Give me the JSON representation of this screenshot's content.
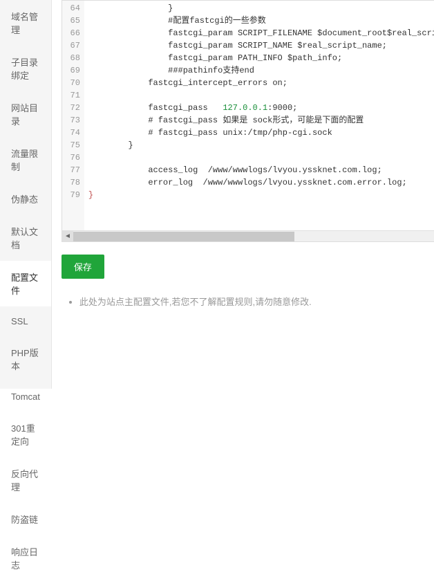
{
  "sidebar": {
    "items": [
      {
        "label": "域名管理"
      },
      {
        "label": "子目录绑定"
      },
      {
        "label": "网站目录"
      },
      {
        "label": "流量限制"
      },
      {
        "label": "伪静态"
      },
      {
        "label": "默认文档"
      },
      {
        "label": "配置文件"
      },
      {
        "label": "SSL"
      },
      {
        "label": "PHP版本"
      },
      {
        "label": "Tomcat"
      },
      {
        "label": "301重定向"
      },
      {
        "label": "反向代理"
      },
      {
        "label": "防盗链"
      },
      {
        "label": "响应日志"
      }
    ],
    "activeIndex": 6
  },
  "editor": {
    "startLine": 64,
    "lines": [
      {
        "indent": 16,
        "text": "}"
      },
      {
        "indent": 16,
        "text": "#配置fastcgi的一些参数"
      },
      {
        "indent": 16,
        "text": "fastcgi_param SCRIPT_FILENAME $document_root$real_script_name;"
      },
      {
        "indent": 16,
        "text": "fastcgi_param SCRIPT_NAME $real_script_name;"
      },
      {
        "indent": 16,
        "text": "fastcgi_param PATH_INFO $path_info;"
      },
      {
        "indent": 16,
        "text": "###pathinfo支持end"
      },
      {
        "indent": 12,
        "text": "fastcgi_intercept_errors on;"
      },
      {
        "indent": 0,
        "text": ""
      },
      {
        "indent": 12,
        "text": "fastcgi_pass   ",
        "num": "127.0.0.1",
        "after": ":9000;"
      },
      {
        "indent": 12,
        "text": "# fastcgi_pass 如果是 sock形式，可能是下面的配置"
      },
      {
        "indent": 12,
        "text": "# fastcgi_pass unix:/tmp/php-cgi.sock"
      },
      {
        "indent": 8,
        "text": "}"
      },
      {
        "indent": 0,
        "text": ""
      },
      {
        "indent": 12,
        "text": "access_log  /www/wwwlogs/lvyou.yssknet.com.log;"
      },
      {
        "indent": 12,
        "text": "error_log  /www/wwwlogs/lvyou.yssknet.com.error.log;"
      },
      {
        "indent": 0,
        "brace": "}"
      }
    ]
  },
  "buttons": {
    "save": "保存"
  },
  "note": "此处为站点主配置文件,若您不了解配置规则,请勿随意修改."
}
